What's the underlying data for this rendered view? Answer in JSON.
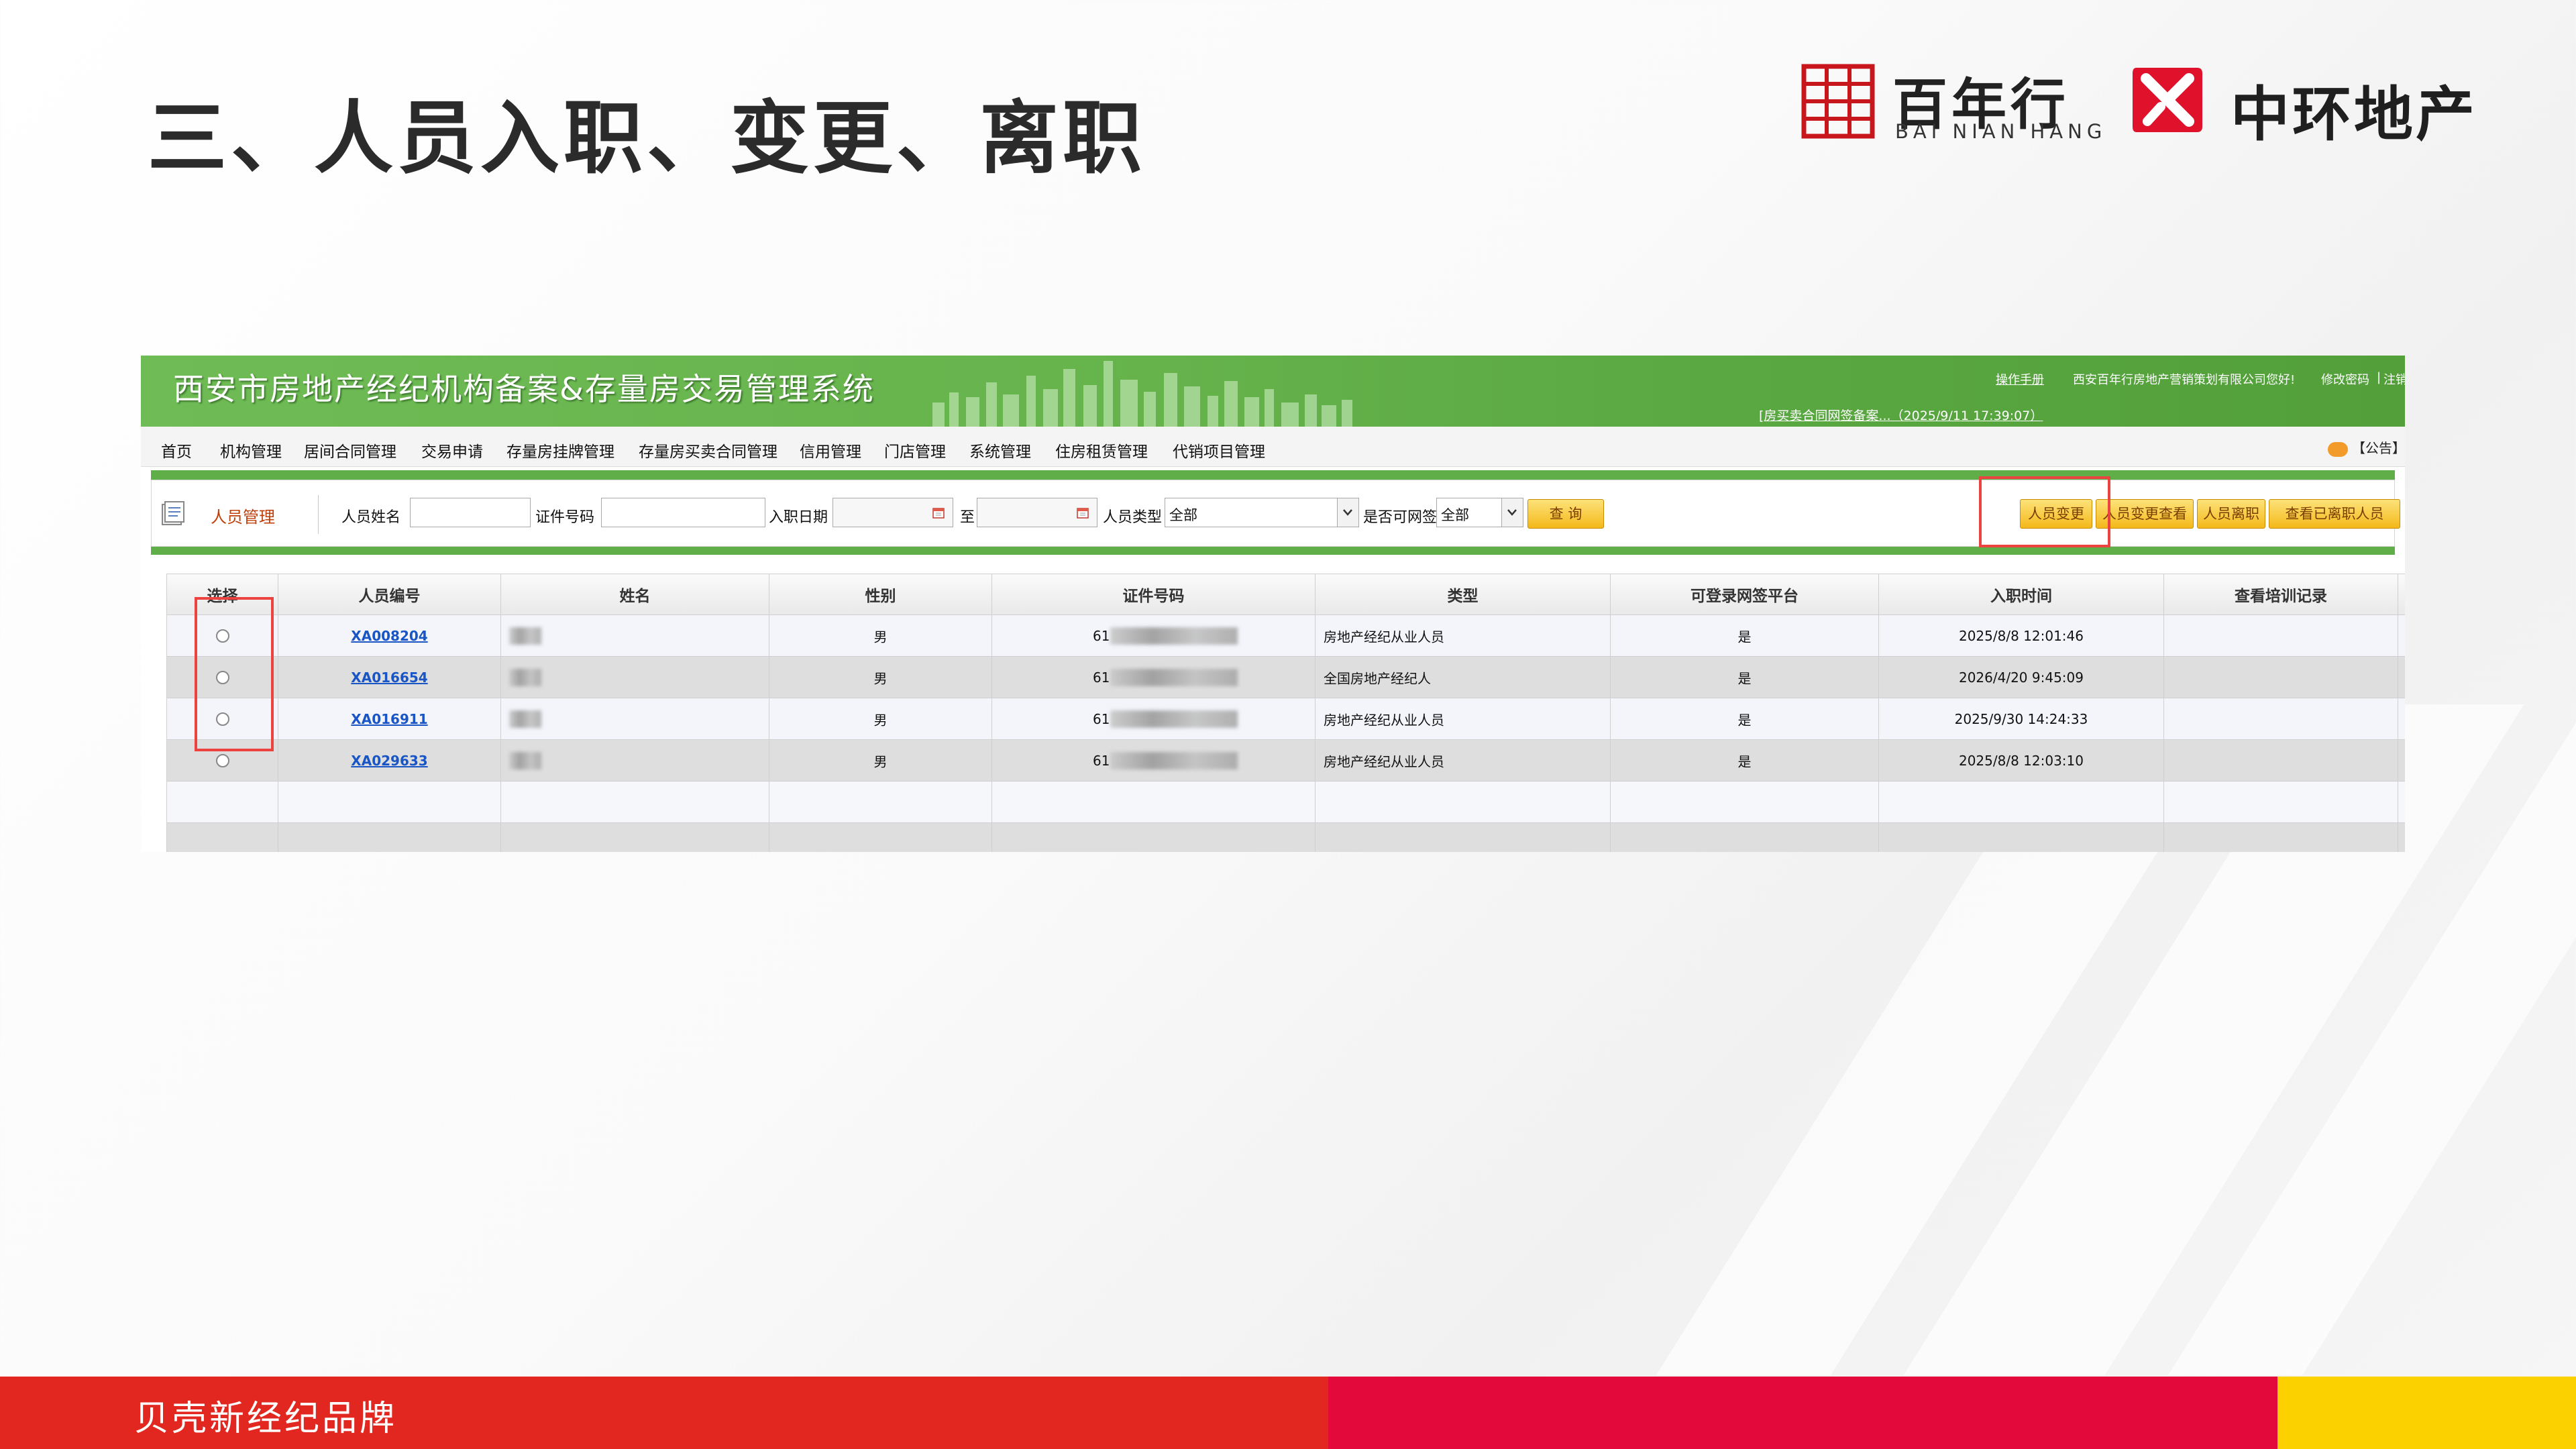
{
  "slide": {
    "title": "三、人员入职、变更、离职",
    "footer_text": "贝壳新经纪品牌"
  },
  "logos": {
    "bainianhang_cn": "百年行",
    "bainianhang_en": "BAI NIAN HANG",
    "zhonghuan_cn": "中环地产"
  },
  "colors": {
    "header_green": "#66b34c",
    "accent_red_box": "#ec4240",
    "footer_red": "#e12720",
    "footer_crimson": "#e3093b",
    "footer_yellow": "#fbd100",
    "link_blue": "#1a55c5",
    "button_yellow": "#f4b91a"
  },
  "app": {
    "title": "西安市房地产经纪机构备案&存量房交易管理系统",
    "header_links": {
      "manual": "操作手册",
      "greeting": "西安百年行房地产营销策划有限公司您好!",
      "change_password": "修改密码",
      "separator": "|",
      "logout": "注销"
    },
    "notice": "[房买卖合同网签备案...（2025/9/11 17:39:07）",
    "menu": [
      "首页",
      "机构管理",
      "居间合同管理",
      "交易申请",
      "存量房挂牌管理",
      "存量房买卖合同管理",
      "信用管理",
      "门店管理",
      "系统管理",
      "住房租赁管理",
      "代销项目管理"
    ],
    "announcement": "【公告】",
    "toolbar": {
      "section_title": "人员管理",
      "name_label": "人员姓名",
      "name_value": "",
      "id_label": "证件号码",
      "id_value": "",
      "date_label": "入职日期",
      "date_from": "",
      "to_label": "至",
      "date_to": "",
      "type_label": "人员类型",
      "type_value": "全部",
      "can_sign_label": "是否可网签",
      "can_sign_value": "全部",
      "search_button": "查 询",
      "actions": [
        "人员变更",
        "人员变更查看",
        "人员离职",
        "查看已离职人员"
      ]
    },
    "table": {
      "columns": [
        "选择",
        "人员编号",
        "姓名",
        "性别",
        "证件号码",
        "类型",
        "可登录网签平台",
        "入职时间",
        "查看培训记录"
      ],
      "rows": [
        {
          "id": "XA008204",
          "name": "",
          "gender": "男",
          "id_number": "61",
          "type": "房地产经纪从业人员",
          "can_login": "是",
          "hire_time": "2025/8/8 12:01:46",
          "training": ""
        },
        {
          "id": "XA016654",
          "name": "",
          "gender": "男",
          "id_number": "61",
          "type": "全国房地产经纪人",
          "can_login": "是",
          "hire_time": "2026/4/20 9:45:09",
          "training": ""
        },
        {
          "id": "XA016911",
          "name": "",
          "gender": "男",
          "id_number": "61",
          "type": "房地产经纪从业人员",
          "can_login": "是",
          "hire_time": "2025/9/30 14:24:33",
          "training": ""
        },
        {
          "id": "XA029633",
          "name": "",
          "gender": "男",
          "id_number": "61",
          "type": "房地产经纪从业人员",
          "can_login": "是",
          "hire_time": "2025/8/8 12:03:10",
          "training": ""
        }
      ]
    }
  }
}
